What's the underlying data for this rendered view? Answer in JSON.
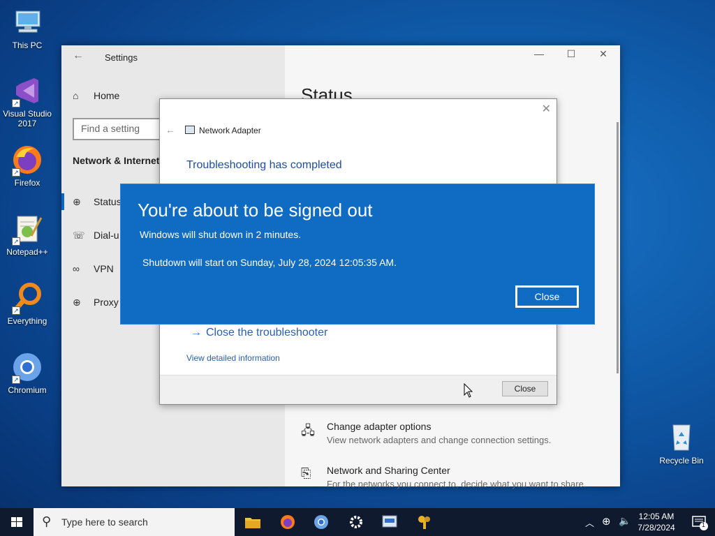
{
  "desktop": {
    "icons": [
      {
        "label": "This PC"
      },
      {
        "label": "Visual Studio 2017"
      },
      {
        "label": "Firefox"
      },
      {
        "label": "Notepad++"
      },
      {
        "label": "Everything"
      },
      {
        "label": "Chromium"
      }
    ],
    "recycle_bin": "Recycle Bin"
  },
  "settings": {
    "title": "Settings",
    "home": "Home",
    "search_placeholder": "Find a setting",
    "section": "Network & Internet",
    "nav": [
      {
        "label": "Status",
        "icon": "globe-network-icon"
      },
      {
        "label": "Dial-u",
        "icon": "dialup-icon"
      },
      {
        "label": "VPN",
        "icon": "vpn-icon"
      },
      {
        "label": "Proxy",
        "icon": "globe-icon"
      }
    ],
    "page_title": "Status",
    "rows": [
      {
        "title": "Change adapter options",
        "sub": "View network adapters and change connection settings."
      },
      {
        "title": "Network and Sharing Center",
        "sub": "For the networks you connect to, decide what you want to share."
      }
    ]
  },
  "troubleshooter": {
    "title": "Network Adapter",
    "status": "Troubleshooting has completed",
    "close_link": "Close the troubleshooter",
    "detail_link": "View detailed information",
    "close_button": "Close"
  },
  "signout": {
    "heading": "You're about to be signed out",
    "line1": "Windows will shut down in 2 minutes.",
    "line2": "Shutdown will start on Sunday, July 28, 2024 12:05:35 AM.",
    "close_button": "Close",
    "colors": {
      "background": "#0f6cc2"
    }
  },
  "taskbar": {
    "search_placeholder": "Type here to search",
    "time": "12:05 AM",
    "date": "7/28/2024",
    "notification_count": "1"
  }
}
